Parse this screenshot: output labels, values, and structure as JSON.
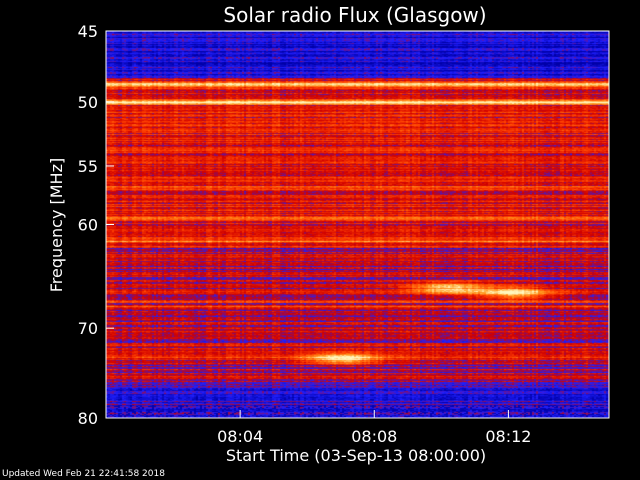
{
  "chart_data": {
    "type": "heatmap",
    "title": "Solar radio Flux (Glasgow)",
    "xlabel": "Start Time (03-Sep-13 08:00:00)",
    "ylabel": "Frequency [MHz]",
    "x_ticks": [
      "08:04",
      "08:08",
      "08:12"
    ],
    "x_tick_minutes": [
      4,
      8,
      12
    ],
    "x_range_minutes": [
      0,
      15
    ],
    "y_ticks": [
      45,
      50,
      55,
      60,
      70,
      80
    ],
    "y_range": [
      45,
      80
    ],
    "y_scale": "log",
    "y_inverted": true,
    "colormap": [
      "#0000a8",
      "#2020ff",
      "#d00000",
      "#ff4000",
      "#ff9a20",
      "#fff8c0"
    ],
    "bright_bands_mhz": [
      48.7,
      50.0,
      56.8,
      59.4,
      61.5,
      66.4,
      67.2,
      67.7,
      71.8,
      73.1
    ],
    "bursts": [
      {
        "time_min": 12.2,
        "freq_mhz": 66.4,
        "label": ""
      },
      {
        "time_min": 10.2,
        "freq_mhz": 65.9,
        "label": ""
      },
      {
        "time_min": 7.0,
        "freq_mhz": 73.2,
        "label": ""
      }
    ],
    "grid": false
  },
  "footer": {
    "updated_text": "Updated Wed Feb 21 22:41:58 2018"
  }
}
